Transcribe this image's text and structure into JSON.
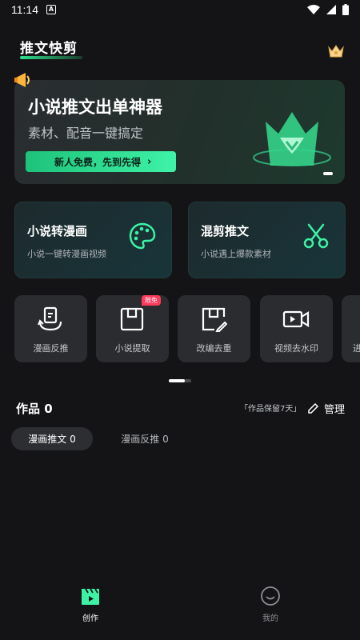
{
  "status_bar": {
    "time": "11:14"
  },
  "header": {
    "title": "推文快剪"
  },
  "banner": {
    "title": "小说推文出单神器",
    "subtitle": "素材、配音一键搞定",
    "cta": "新人免费，先到先得",
    "cta_chevron": "›"
  },
  "feature_cards": [
    {
      "title": "小说转漫画",
      "subtitle": "小说一键转漫画视频",
      "icon": "palette-icon"
    },
    {
      "title": "混剪推文",
      "subtitle": "小说遇上爆款素材",
      "icon": "scissors-icon"
    }
  ],
  "tools": [
    {
      "label": "漫画反推",
      "icon": "reverse-icon"
    },
    {
      "label": "小说提取",
      "icon": "save-box-icon",
      "badge": "限免"
    },
    {
      "label": "改编去重",
      "icon": "edit-box-icon"
    },
    {
      "label": "视频去水印",
      "icon": "video-icon"
    },
    {
      "label": "进",
      "icon": "partial-icon"
    }
  ],
  "works": {
    "title": "作品 0",
    "keep_note": "「作品保留7天」",
    "manage_label": "管理"
  },
  "tabs": [
    {
      "label": "漫画推文 0",
      "active": true
    },
    {
      "label": "漫画反推 0",
      "active": false
    }
  ],
  "bottom_nav": [
    {
      "label": "创作",
      "active": true
    },
    {
      "label": "我的",
      "active": false
    }
  ],
  "colors": {
    "accent": "#2de08a",
    "badge": "#ff3b5c",
    "background": "#141416"
  }
}
